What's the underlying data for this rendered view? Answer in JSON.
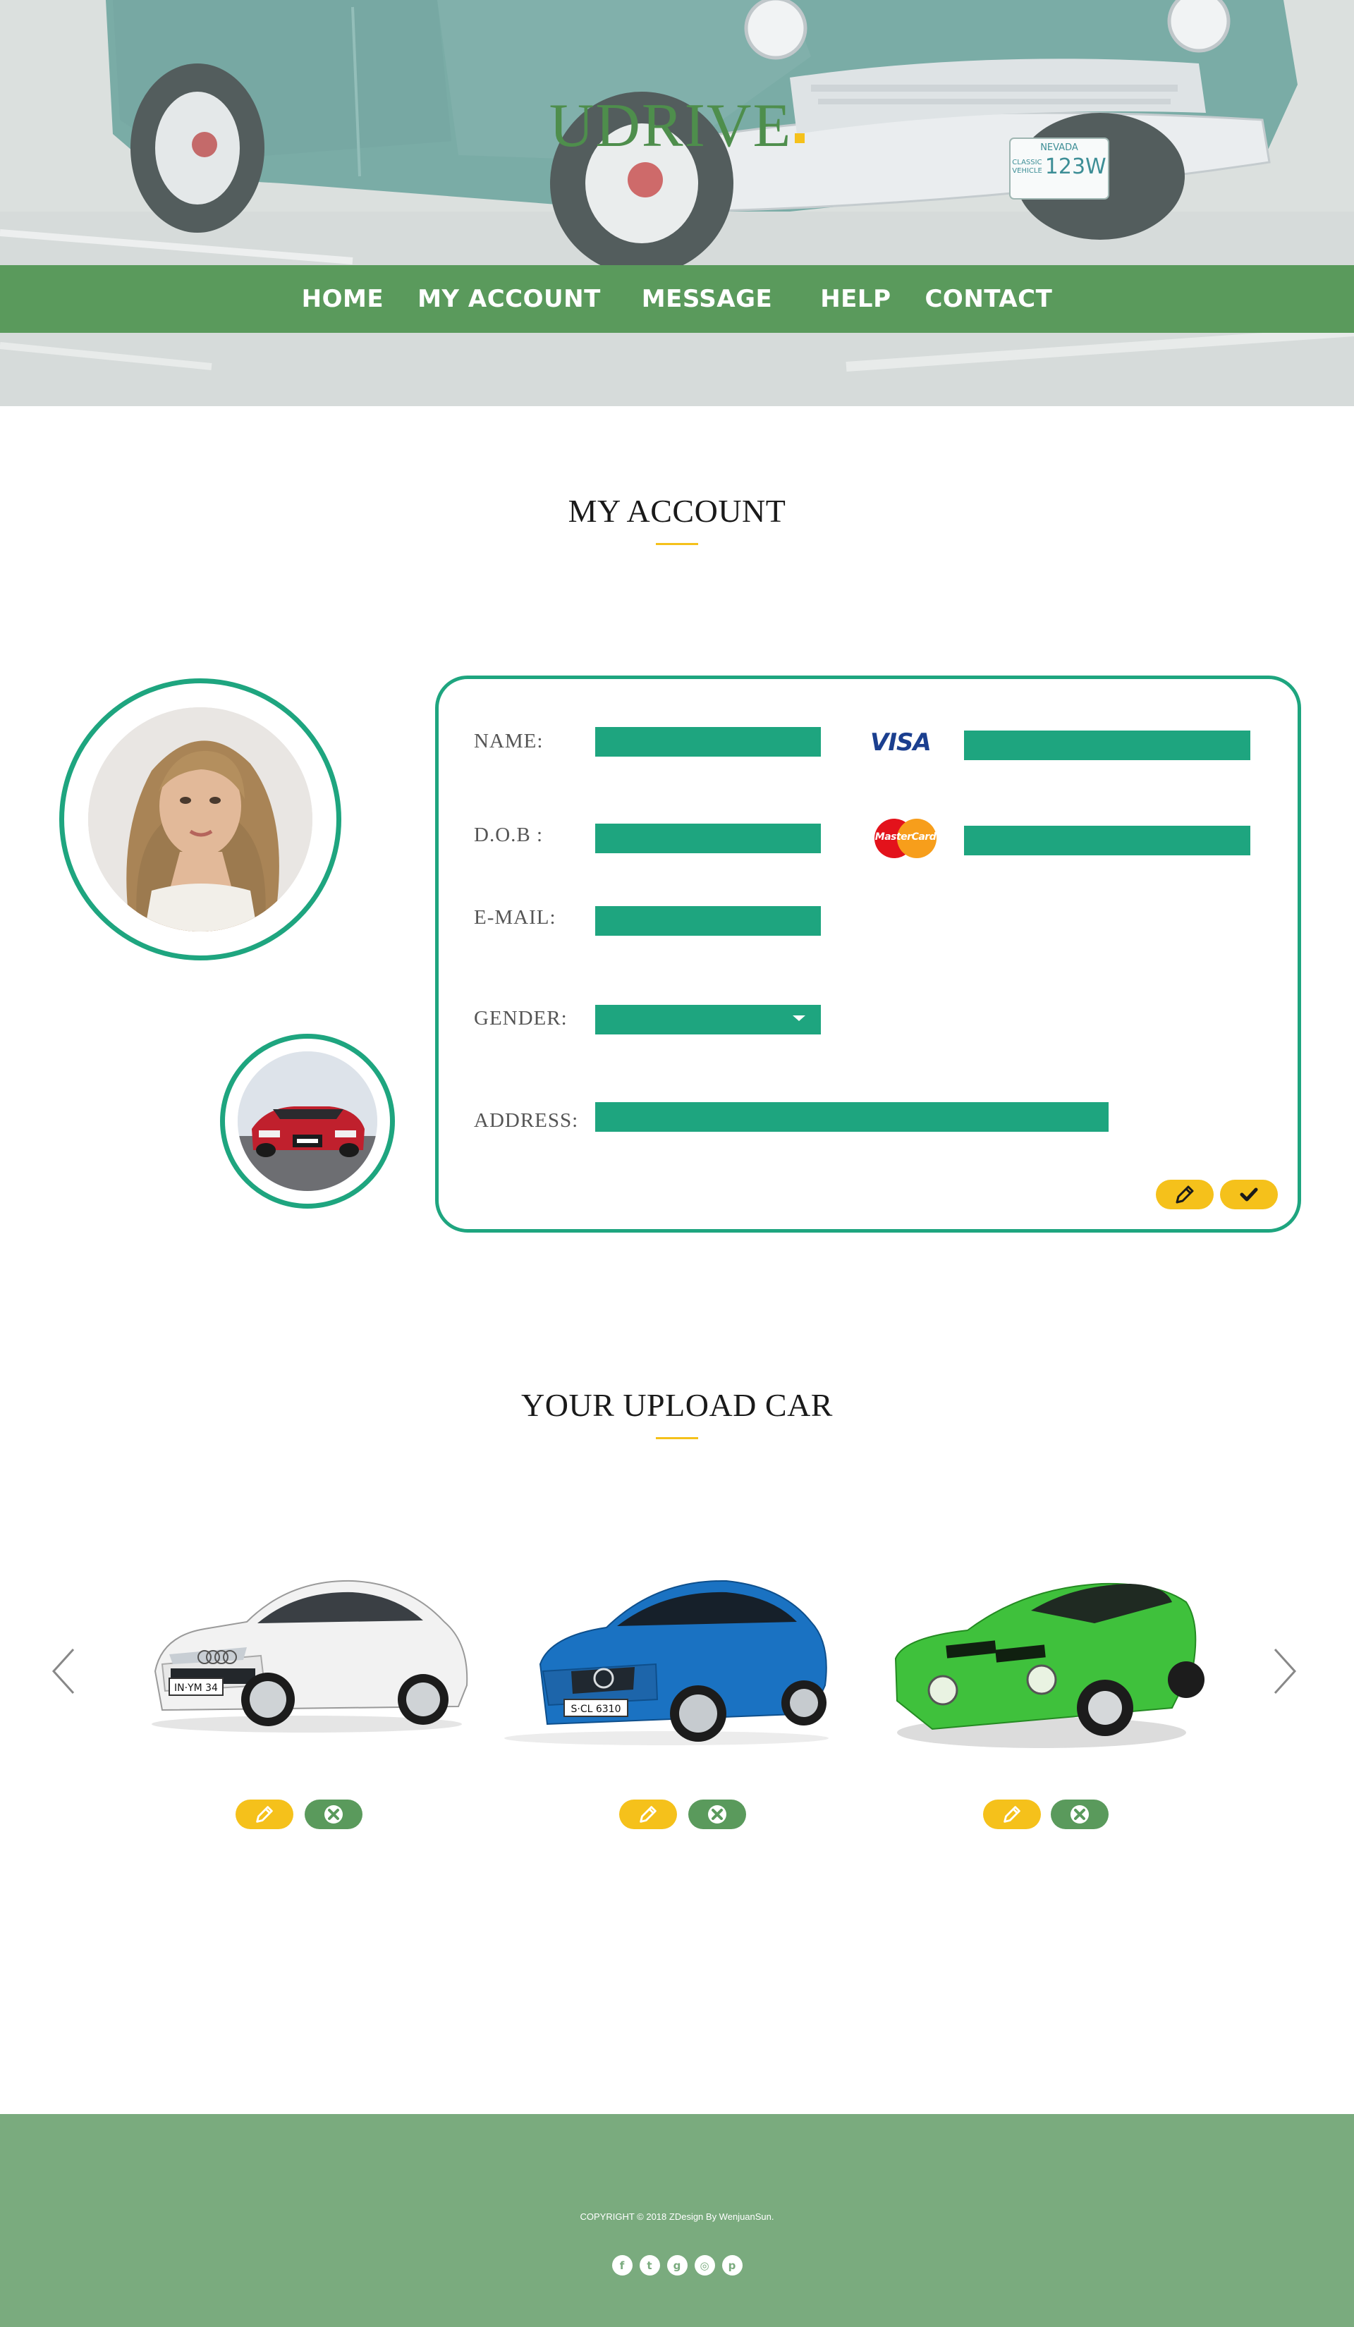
{
  "brand": {
    "logo_text": "UDRIVE",
    "accent_color": "#f5c11b",
    "logo_color": "#4e8e4c"
  },
  "nav": {
    "items": [
      {
        "label": "HOME"
      },
      {
        "label": "MY ACCOUNT"
      },
      {
        "label": "MESSAGE"
      },
      {
        "label": "HELP"
      },
      {
        "label": "CONTACT"
      }
    ],
    "bg_color": "#5a9a5c"
  },
  "hero": {
    "plate_state": "NEVADA",
    "plate_line1": "CLASSIC",
    "plate_line2": "VEHICLE",
    "plate_number": "123W"
  },
  "account": {
    "title": "MY ACCOUNT",
    "fields": {
      "name_label": "NAME:",
      "dob_label": "D.O.B :",
      "email_label": "E-MAIL:",
      "gender_label": "GENDER:",
      "address_label": "ADDRESS:"
    },
    "cards": {
      "visa_text": "VISA",
      "mastercard_text": "MasterCard"
    },
    "field_color": "#1ea57f",
    "actions": {
      "edit_icon": "pencil-icon",
      "confirm_icon": "check-icon"
    }
  },
  "uploads": {
    "title": "YOUR UPLOAD CAR",
    "cars": [
      {
        "name": "white-coupe",
        "plate": "IN·YM 34",
        "color": "#f4f4f4"
      },
      {
        "name": "blue-sedan",
        "plate": "S·CL 6310",
        "color": "#1a72c2"
      },
      {
        "name": "green-sportscar",
        "plate": "",
        "color": "#3fc13c"
      }
    ],
    "actions": {
      "edit_icon": "pencil-icon",
      "delete_icon": "close-icon"
    }
  },
  "footer": {
    "copyright": "COPYRIGHT © 2018 ZDesign By WenjuanSun.",
    "social": [
      {
        "icon": "facebook-icon",
        "glyph": "f"
      },
      {
        "icon": "twitter-icon",
        "glyph": "t"
      },
      {
        "icon": "googleplus-icon",
        "glyph": "g"
      },
      {
        "icon": "instagram-icon",
        "glyph": "◎"
      },
      {
        "icon": "pinterest-icon",
        "glyph": "p"
      }
    ],
    "bg_color": "#7aab7e"
  }
}
